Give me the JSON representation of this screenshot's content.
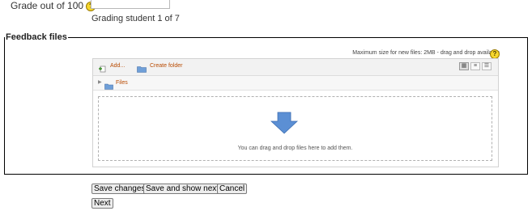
{
  "grade": {
    "label": "Grade out of 100",
    "help_icon": "question-icon",
    "value": ""
  },
  "grading_status": "Grading student 1 of 7",
  "feedback_files": {
    "legend": "Feedback files",
    "max_size_text": "Maximum size for new files: 2MB - drag and drop available",
    "help_icon": "question-icon",
    "toolbar": {
      "add_label": "Add...",
      "add_icon": "add-file-icon",
      "create_folder_label": "Create folder",
      "create_folder_icon": "folder-icon",
      "view_modes": [
        "icons-view-icon",
        "list-view-icon",
        "tree-view-icon"
      ]
    },
    "path": {
      "expand_icon": "triangle-right-icon",
      "folder_icon": "folder-icon",
      "label": "Files"
    },
    "dropzone": {
      "arrow_icon": "download-arrow-icon",
      "text": "You can drag and drop files here to add them."
    }
  },
  "buttons": {
    "save_changes": "Save changes",
    "save_and_show_next": "Save and show next",
    "cancel": "Cancel",
    "next": "Next"
  },
  "colors": {
    "link_orange": "#b84a00",
    "help_yellow": "#f6d72e",
    "drop_arrow_blue": "#5b8fd4"
  }
}
